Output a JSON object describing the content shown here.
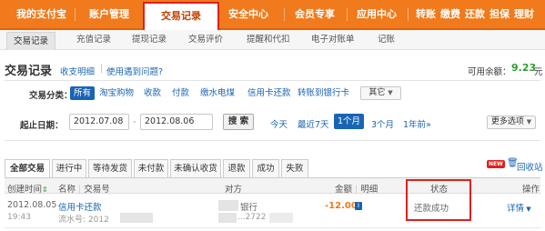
{
  "topnav": {
    "items": [
      "我的支付宝",
      "账户管理",
      "交易记录",
      "安全中心",
      "会员专享",
      "应用中心"
    ],
    "shortcuts": [
      "转账",
      "缴费",
      "还款",
      "担保",
      "理财"
    ]
  },
  "subnav": {
    "items": [
      "交易记录",
      "充值记录",
      "提现记录",
      "交易评价",
      "提醒和代扣",
      "电子对账单",
      "记账"
    ]
  },
  "header": {
    "title": "交易记录",
    "link1": "收支明细",
    "divider": "|",
    "link2": "使用遇到问题?",
    "balance_label": "可用余额：",
    "balance_value": "9.23",
    "balance_unit": "元"
  },
  "category": {
    "label": "交易分类：",
    "items": [
      "所有",
      "淘宝购物",
      "收款",
      "付款",
      "缴水电煤",
      "信用卡还款",
      "转账到银行卡"
    ],
    "more": "其它"
  },
  "date_filter": {
    "label": "起止日期：",
    "start": "2012.07.08",
    "dash": "-",
    "end": "2012.08.06",
    "search": "搜 索",
    "quick": [
      "今天",
      "最近7天",
      "1个月",
      "3个月",
      "1年前"
    ],
    "quick_more": "»",
    "more_options": "更多选项"
  },
  "tabs": {
    "items": [
      "全部交易",
      "进行中",
      "等待发货",
      "未付款",
      "未确认收货",
      "退款",
      "成功",
      "失败"
    ],
    "new_badge": "NEW",
    "recycle": "回收站"
  },
  "table": {
    "columns": {
      "time": "创建时间",
      "name": "名称",
      "order": "交易号",
      "party": "对方",
      "amount": "金额",
      "detail": "明细",
      "status": "状态",
      "action": "操作"
    },
    "rows": [
      {
        "date": "2012.08.05",
        "time": "19:43",
        "name": "信用卡还款",
        "serial": "流水号: 2012",
        "party": "银行",
        "party_sub": "...2722 | *",
        "amount": "-12.00",
        "status": "还款成功",
        "action": "详情"
      }
    ]
  },
  "colors": {
    "nav_orange": "#f07a1c",
    "highlight_red": "#e0201b",
    "link_blue": "#1a64b4",
    "amount_orange": "#f07a1c",
    "balance_green": "#2e9e2e"
  }
}
